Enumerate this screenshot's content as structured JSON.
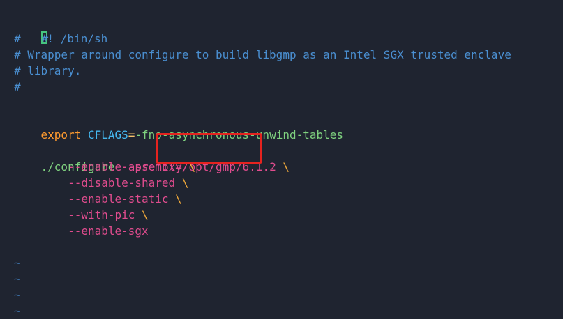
{
  "editor": {
    "lines": {
      "l1": {
        "cursor_char": "#",
        "text": "! /bin/sh"
      },
      "l2": {
        "text": "#"
      },
      "l3": {
        "text": "# Wrapper around configure to build libgmp as an Intel SGX trusted enclave"
      },
      "l4": {
        "text": "# library."
      },
      "l5": {
        "text": "#"
      },
      "l7": {
        "keyword": "export",
        "var": "CFLAGS",
        "equals": "=",
        "value": "-fno-asynchronous-unwind-tables"
      },
      "l9": {
        "cmd": "./configure",
        "flag": "--prefix",
        "equals": "=",
        "path": "/opt/gmp/6.1.2",
        "backslash": "\\"
      },
      "l10": {
        "flag": "--enable-assembly",
        "backslash": "\\"
      },
      "l11": {
        "flag": "--disable-shared",
        "backslash": "\\"
      },
      "l12": {
        "flag": "--enable-static",
        "backslash": "\\"
      },
      "l13": {
        "flag": "--with-pic",
        "backslash": "\\"
      },
      "l14": {
        "flag": "--enable-sgx"
      }
    },
    "empty_line_marker": "~"
  },
  "colors": {
    "background": "#1f2430",
    "comment": "#4a8fd1",
    "keyword": "#ff9b2f",
    "variable": "#45b8f0",
    "string": "#7fd27f",
    "flag": "#e04c8e",
    "backslash": "#f0a93a",
    "highlight_border": "#e5231f"
  }
}
